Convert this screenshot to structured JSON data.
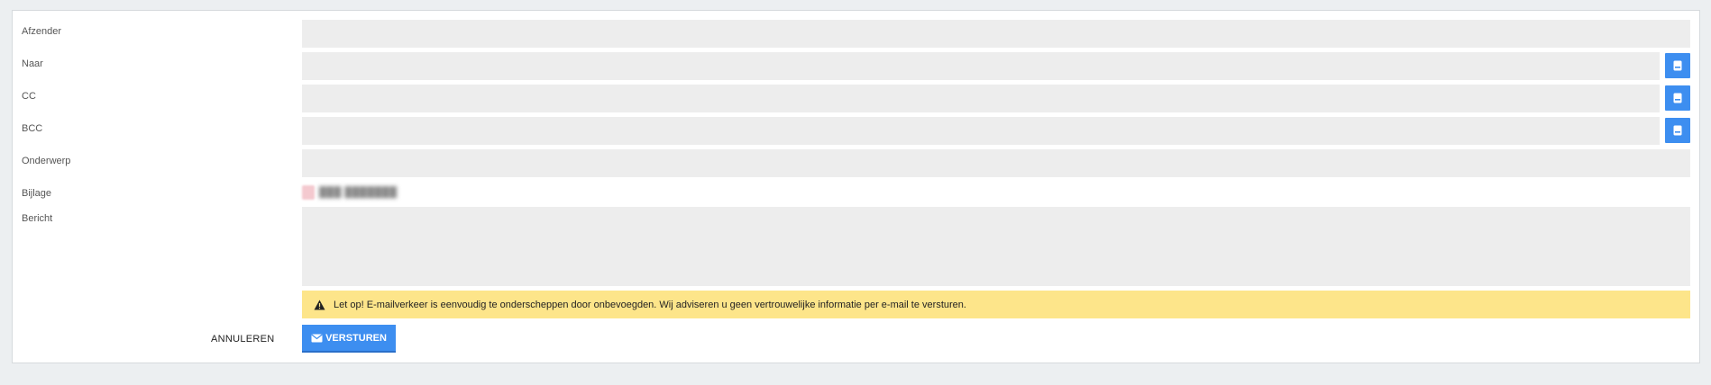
{
  "form": {
    "sender_label": "Afzender",
    "to_label": "Naar",
    "cc_label": "CC",
    "bcc_label": "BCC",
    "subject_label": "Onderwerp",
    "attachment_label": "Bijlage",
    "message_label": "Bericht",
    "sender_value": "",
    "to_value": "",
    "cc_value": "",
    "bcc_value": "",
    "subject_value": "",
    "message_value": ""
  },
  "attachment": {
    "icon": "pdf-file-icon",
    "name": "███ ███████"
  },
  "address_book_icon": "address-book-icon",
  "warning": {
    "icon": "warning-triangle-icon",
    "text": "Let op! E-mailverkeer is eenvoudig te onderscheppen door onbevoegden. Wij adviseren u geen vertrouwelijke informatie per e-mail te versturen.",
    "color": "#FDE58A"
  },
  "actions": {
    "cancel_label": "ANNULEREN",
    "send_label": "VERSTUREN",
    "send_icon": "envelope-icon",
    "accent": "#3D8EF0"
  }
}
